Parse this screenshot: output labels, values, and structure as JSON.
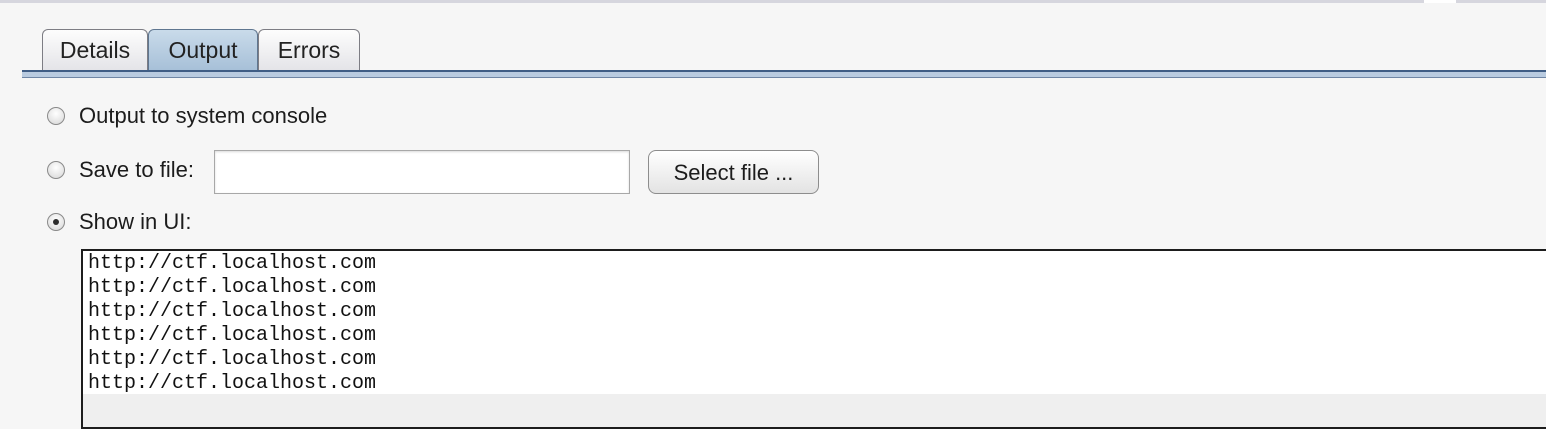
{
  "tabs": [
    {
      "label": "Details",
      "selected": false
    },
    {
      "label": "Output",
      "selected": true
    },
    {
      "label": "Errors",
      "selected": false
    }
  ],
  "options": {
    "console_label": "Output to system console",
    "file_label": "Save to file:",
    "ui_label": "Show in UI:",
    "selected": "ui"
  },
  "file": {
    "value": "",
    "button_label": "Select file ..."
  },
  "output": {
    "lines": [
      "http://ctf.localhost.com",
      "http://ctf.localhost.com",
      "http://ctf.localhost.com",
      "http://ctf.localhost.com",
      "http://ctf.localhost.com",
      "http://ctf.localhost.com"
    ]
  },
  "colors": {
    "selected_tab": "#a7c0d8",
    "tab_border_accent": "#3f5d85"
  }
}
